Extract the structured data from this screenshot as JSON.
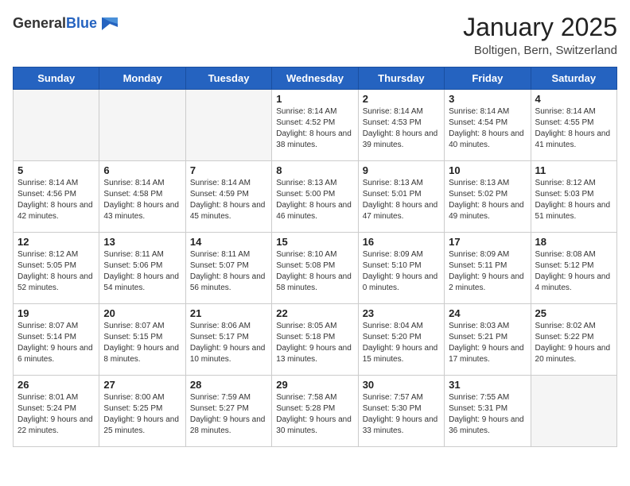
{
  "header": {
    "logo_general": "General",
    "logo_blue": "Blue",
    "month_title": "January 2025",
    "location": "Boltigen, Bern, Switzerland"
  },
  "weekdays": [
    "Sunday",
    "Monday",
    "Tuesday",
    "Wednesday",
    "Thursday",
    "Friday",
    "Saturday"
  ],
  "weeks": [
    [
      {
        "day": "",
        "sunrise": "",
        "sunset": "",
        "daylight": ""
      },
      {
        "day": "",
        "sunrise": "",
        "sunset": "",
        "daylight": ""
      },
      {
        "day": "",
        "sunrise": "",
        "sunset": "",
        "daylight": ""
      },
      {
        "day": "1",
        "sunrise": "Sunrise: 8:14 AM",
        "sunset": "Sunset: 4:52 PM",
        "daylight": "Daylight: 8 hours and 38 minutes."
      },
      {
        "day": "2",
        "sunrise": "Sunrise: 8:14 AM",
        "sunset": "Sunset: 4:53 PM",
        "daylight": "Daylight: 8 hours and 39 minutes."
      },
      {
        "day": "3",
        "sunrise": "Sunrise: 8:14 AM",
        "sunset": "Sunset: 4:54 PM",
        "daylight": "Daylight: 8 hours and 40 minutes."
      },
      {
        "day": "4",
        "sunrise": "Sunrise: 8:14 AM",
        "sunset": "Sunset: 4:55 PM",
        "daylight": "Daylight: 8 hours and 41 minutes."
      }
    ],
    [
      {
        "day": "5",
        "sunrise": "Sunrise: 8:14 AM",
        "sunset": "Sunset: 4:56 PM",
        "daylight": "Daylight: 8 hours and 42 minutes."
      },
      {
        "day": "6",
        "sunrise": "Sunrise: 8:14 AM",
        "sunset": "Sunset: 4:58 PM",
        "daylight": "Daylight: 8 hours and 43 minutes."
      },
      {
        "day": "7",
        "sunrise": "Sunrise: 8:14 AM",
        "sunset": "Sunset: 4:59 PM",
        "daylight": "Daylight: 8 hours and 45 minutes."
      },
      {
        "day": "8",
        "sunrise": "Sunrise: 8:13 AM",
        "sunset": "Sunset: 5:00 PM",
        "daylight": "Daylight: 8 hours and 46 minutes."
      },
      {
        "day": "9",
        "sunrise": "Sunrise: 8:13 AM",
        "sunset": "Sunset: 5:01 PM",
        "daylight": "Daylight: 8 hours and 47 minutes."
      },
      {
        "day": "10",
        "sunrise": "Sunrise: 8:13 AM",
        "sunset": "Sunset: 5:02 PM",
        "daylight": "Daylight: 8 hours and 49 minutes."
      },
      {
        "day": "11",
        "sunrise": "Sunrise: 8:12 AM",
        "sunset": "Sunset: 5:03 PM",
        "daylight": "Daylight: 8 hours and 51 minutes."
      }
    ],
    [
      {
        "day": "12",
        "sunrise": "Sunrise: 8:12 AM",
        "sunset": "Sunset: 5:05 PM",
        "daylight": "Daylight: 8 hours and 52 minutes."
      },
      {
        "day": "13",
        "sunrise": "Sunrise: 8:11 AM",
        "sunset": "Sunset: 5:06 PM",
        "daylight": "Daylight: 8 hours and 54 minutes."
      },
      {
        "day": "14",
        "sunrise": "Sunrise: 8:11 AM",
        "sunset": "Sunset: 5:07 PM",
        "daylight": "Daylight: 8 hours and 56 minutes."
      },
      {
        "day": "15",
        "sunrise": "Sunrise: 8:10 AM",
        "sunset": "Sunset: 5:08 PM",
        "daylight": "Daylight: 8 hours and 58 minutes."
      },
      {
        "day": "16",
        "sunrise": "Sunrise: 8:09 AM",
        "sunset": "Sunset: 5:10 PM",
        "daylight": "Daylight: 9 hours and 0 minutes."
      },
      {
        "day": "17",
        "sunrise": "Sunrise: 8:09 AM",
        "sunset": "Sunset: 5:11 PM",
        "daylight": "Daylight: 9 hours and 2 minutes."
      },
      {
        "day": "18",
        "sunrise": "Sunrise: 8:08 AM",
        "sunset": "Sunset: 5:12 PM",
        "daylight": "Daylight: 9 hours and 4 minutes."
      }
    ],
    [
      {
        "day": "19",
        "sunrise": "Sunrise: 8:07 AM",
        "sunset": "Sunset: 5:14 PM",
        "daylight": "Daylight: 9 hours and 6 minutes."
      },
      {
        "day": "20",
        "sunrise": "Sunrise: 8:07 AM",
        "sunset": "Sunset: 5:15 PM",
        "daylight": "Daylight: 9 hours and 8 minutes."
      },
      {
        "day": "21",
        "sunrise": "Sunrise: 8:06 AM",
        "sunset": "Sunset: 5:17 PM",
        "daylight": "Daylight: 9 hours and 10 minutes."
      },
      {
        "day": "22",
        "sunrise": "Sunrise: 8:05 AM",
        "sunset": "Sunset: 5:18 PM",
        "daylight": "Daylight: 9 hours and 13 minutes."
      },
      {
        "day": "23",
        "sunrise": "Sunrise: 8:04 AM",
        "sunset": "Sunset: 5:20 PM",
        "daylight": "Daylight: 9 hours and 15 minutes."
      },
      {
        "day": "24",
        "sunrise": "Sunrise: 8:03 AM",
        "sunset": "Sunset: 5:21 PM",
        "daylight": "Daylight: 9 hours and 17 minutes."
      },
      {
        "day": "25",
        "sunrise": "Sunrise: 8:02 AM",
        "sunset": "Sunset: 5:22 PM",
        "daylight": "Daylight: 9 hours and 20 minutes."
      }
    ],
    [
      {
        "day": "26",
        "sunrise": "Sunrise: 8:01 AM",
        "sunset": "Sunset: 5:24 PM",
        "daylight": "Daylight: 9 hours and 22 minutes."
      },
      {
        "day": "27",
        "sunrise": "Sunrise: 8:00 AM",
        "sunset": "Sunset: 5:25 PM",
        "daylight": "Daylight: 9 hours and 25 minutes."
      },
      {
        "day": "28",
        "sunrise": "Sunrise: 7:59 AM",
        "sunset": "Sunset: 5:27 PM",
        "daylight": "Daylight: 9 hours and 28 minutes."
      },
      {
        "day": "29",
        "sunrise": "Sunrise: 7:58 AM",
        "sunset": "Sunset: 5:28 PM",
        "daylight": "Daylight: 9 hours and 30 minutes."
      },
      {
        "day": "30",
        "sunrise": "Sunrise: 7:57 AM",
        "sunset": "Sunset: 5:30 PM",
        "daylight": "Daylight: 9 hours and 33 minutes."
      },
      {
        "day": "31",
        "sunrise": "Sunrise: 7:55 AM",
        "sunset": "Sunset: 5:31 PM",
        "daylight": "Daylight: 9 hours and 36 minutes."
      },
      {
        "day": "",
        "sunrise": "",
        "sunset": "",
        "daylight": ""
      }
    ]
  ]
}
